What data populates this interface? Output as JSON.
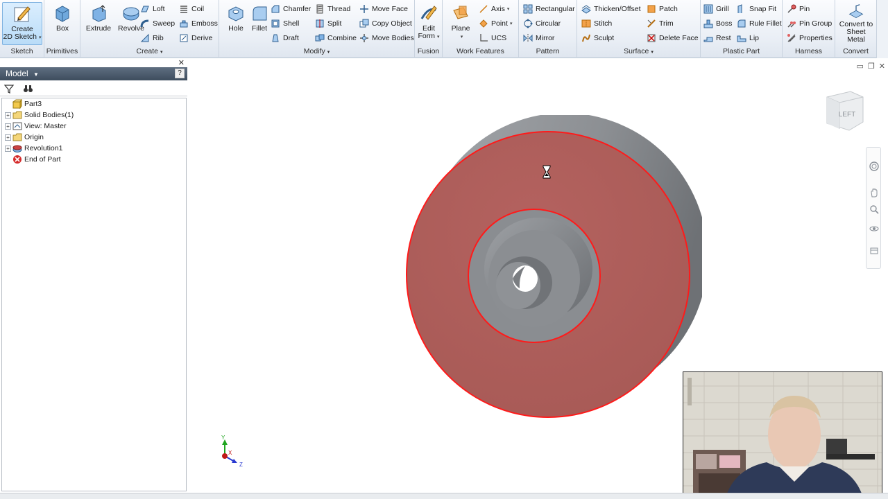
{
  "ribbon": {
    "sketch": {
      "create_2d_sketch": "Create\n2D Sketch",
      "panel_label": "Sketch"
    },
    "primitives": {
      "box": "Box",
      "panel_label": "Primitives"
    },
    "create": {
      "extrude": "Extrude",
      "revolve": "Revolve",
      "loft": "Loft",
      "sweep": "Sweep",
      "rib": "Rib",
      "coil": "Coil",
      "emboss": "Emboss",
      "derive": "Derive",
      "panel_label": "Create"
    },
    "modify": {
      "hole": "Hole",
      "fillet": "Fillet",
      "chamfer": "Chamfer",
      "shell": "Shell",
      "draft": "Draft",
      "thread": "Thread",
      "split": "Split",
      "combine": "Combine",
      "move_face": "Move Face",
      "copy_object": "Copy Object",
      "move_bodies": "Move Bodies",
      "panel_label": "Modify"
    },
    "fusion": {
      "edit_form": "Edit\nForm",
      "panel_label": "Fusion"
    },
    "work_features": {
      "plane": "Plane",
      "axis": "Axis",
      "point": "Point",
      "ucs": "UCS",
      "panel_label": "Work Features"
    },
    "pattern": {
      "rectangular": "Rectangular",
      "circular": "Circular",
      "mirror": "Mirror",
      "panel_label": "Pattern"
    },
    "surface": {
      "thicken_offset": "Thicken/Offset",
      "stitch": "Stitch",
      "sculpt": "Sculpt",
      "patch": "Patch",
      "trim": "Trim",
      "delete_face": "Delete Face",
      "panel_label": "Surface"
    },
    "plastic_part": {
      "grill": "Grill",
      "boss": "Boss",
      "rest": "Rest",
      "snap_fit": "Snap Fit",
      "rule_fillet": "Rule Fillet",
      "lip": "Lip",
      "panel_label": "Plastic Part"
    },
    "harness": {
      "pin": "Pin",
      "pin_group": "Pin Group",
      "properties": "Properties",
      "panel_label": "Harness"
    },
    "convert": {
      "convert_to_sheet_metal": "Convert to\nSheet Metal",
      "panel_label": "Convert"
    }
  },
  "browser": {
    "title": "Model",
    "tree": [
      {
        "label": "Part3",
        "icon": "part-icon",
        "expander": "",
        "indent": 0
      },
      {
        "label": "Solid Bodies(1)",
        "icon": "folder-icon",
        "expander": "+",
        "indent": 1
      },
      {
        "label": "View: Master",
        "icon": "view-icon",
        "expander": "+",
        "indent": 1
      },
      {
        "label": "Origin",
        "icon": "folder-icon",
        "expander": "+",
        "indent": 1
      },
      {
        "label": "Revolution1",
        "icon": "revolve-feature-icon",
        "expander": "+",
        "indent": 1
      },
      {
        "label": "End of Part",
        "icon": "end-of-part-icon",
        "expander": "",
        "indent": 1
      }
    ]
  },
  "viewcube": {
    "face_label": "LEFT"
  },
  "triad": {
    "y_label": "Y",
    "x_label": "X",
    "z_label": "Z"
  },
  "colors": {
    "selected_face": "#b0625e",
    "edge_highlight": "#ff0000",
    "body_gray": "#8a8d91",
    "ribbon_accent": "#3a7cc0"
  }
}
